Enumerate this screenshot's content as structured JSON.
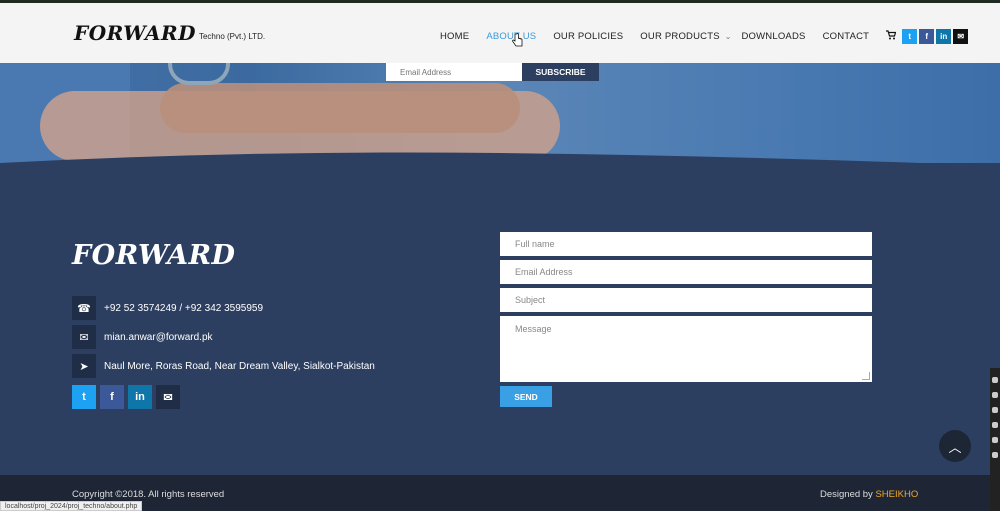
{
  "header": {
    "logo_word": "FORWARD",
    "logo_sub": "Techno (Pvt.) LTD.",
    "nav": [
      {
        "label": "HOME",
        "active": false
      },
      {
        "label": "ABOUT US",
        "active": true
      },
      {
        "label": "OUR POLICIES",
        "active": false
      },
      {
        "label": "OUR PRODUCTS",
        "active": false
      },
      {
        "label": "DOWNLOADS",
        "active": false
      },
      {
        "label": "CONTACT",
        "active": false
      }
    ],
    "icons": [
      "cart-icon",
      "twitter-icon",
      "facebook-icon",
      "linkedin-icon",
      "email-icon"
    ]
  },
  "subscribe": {
    "placeholder": "Email Address",
    "button": "SUBSCRIBE"
  },
  "footer": {
    "logo_word": "FORWARD",
    "phone": "+92 52 3574249 / +92 342 3595959",
    "email": "mian.anwar@forward.pk",
    "address": "Naul More, Roras Road, Near Dream Valley, Sialkot-Pakistan",
    "form": {
      "full_name": "Full name",
      "email": "Email Address",
      "subject": "Subject",
      "message": "Message",
      "send": "SEND"
    }
  },
  "bottom": {
    "copyright": "Copyright ©2018. All rights reserved",
    "designed_by": "Designed by ",
    "designer": "SHEIKHO"
  },
  "status_url": "localhost/proj_2024/proj_techno/about.php",
  "colors": {
    "footer_bg": "#2d3f60",
    "bottom_bg": "#1e2636",
    "accent_blue": "#3a9ad9",
    "designer_orange": "#f5a623"
  }
}
